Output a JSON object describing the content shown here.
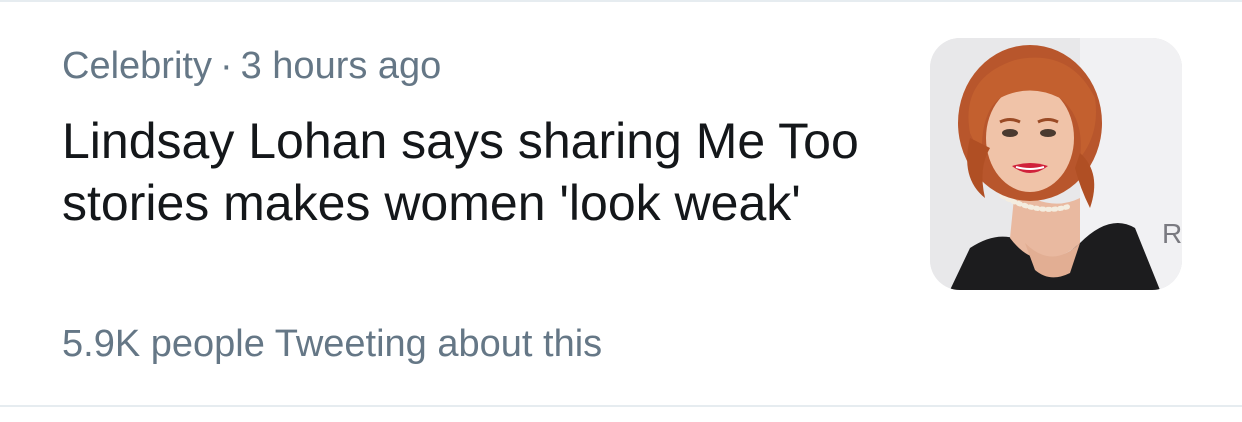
{
  "trend": {
    "category": "Celebrity",
    "separator": "·",
    "time": "3 hours ago",
    "headline": "Lindsay Lohan says sharing Me Too stories makes women 'look weak'",
    "tweet_count": "5.9K people Tweeting about this",
    "thumbnail": {
      "icon": "news-photo",
      "watermark": "R"
    }
  }
}
